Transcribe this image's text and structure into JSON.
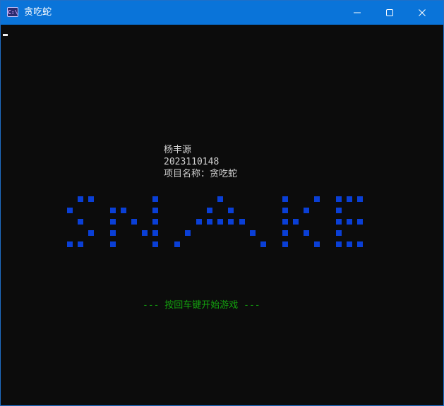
{
  "window": {
    "title": "贪吃蛇",
    "app_icon_text": "C:\\",
    "accent_color": "#0a74d9"
  },
  "console": {
    "background_color": "#0c0c0c",
    "author_name": "杨丰源",
    "student_id": "2023110148",
    "project_line": "项目名称：贪吃蛇",
    "prompt": "--- 按回车键开始游戏 ---",
    "logo_color": "#0a3fd6",
    "prompt_color": "#13a10e"
  },
  "icons": [
    "minimize-icon",
    "maximize-icon",
    "close-icon",
    "console-app-icon"
  ]
}
